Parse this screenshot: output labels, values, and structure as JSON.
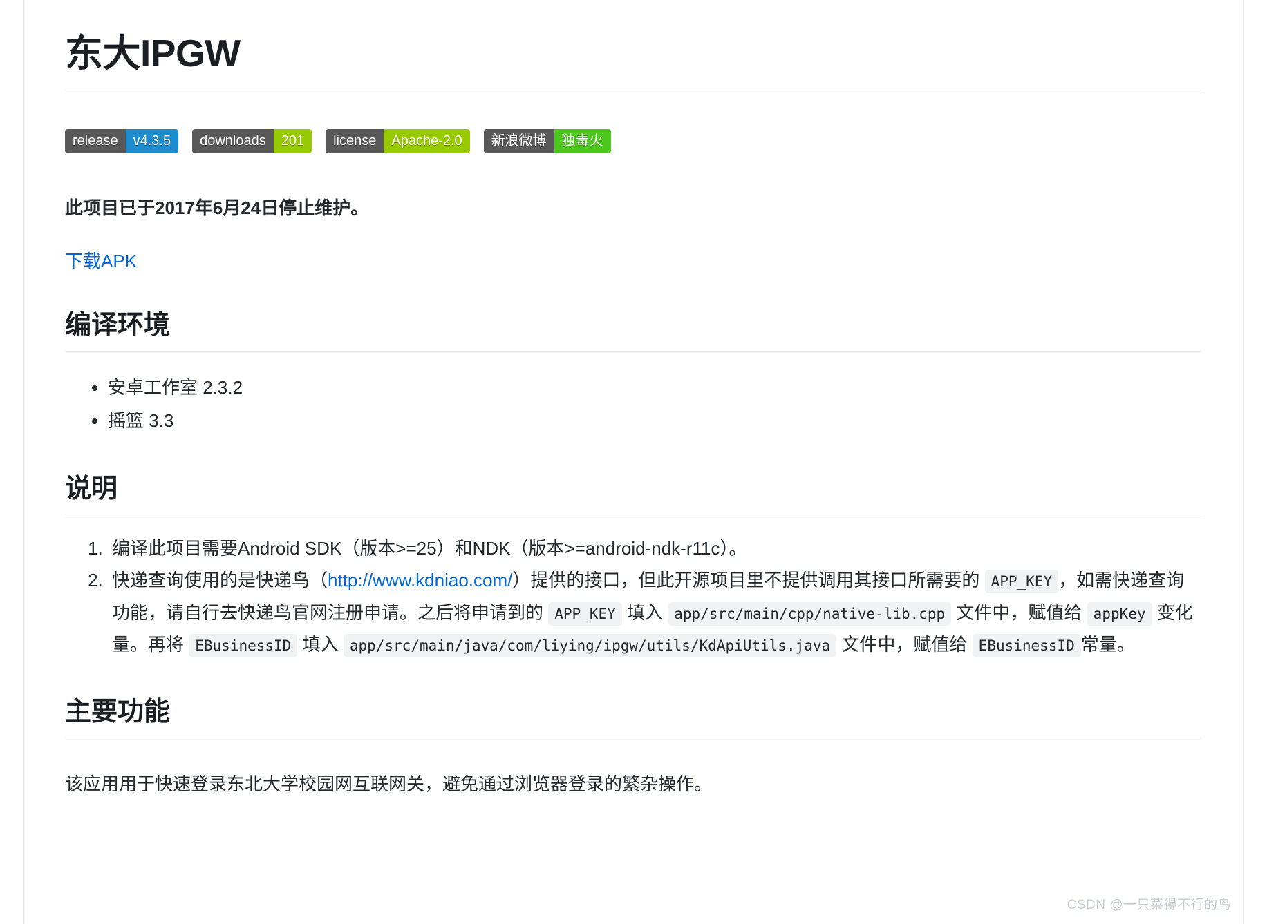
{
  "document": {
    "title": "东大IPGW"
  },
  "badges": [
    {
      "label": "release",
      "value": "v4.3.5",
      "label_color": "#595959",
      "value_color": "#1e8bcd"
    },
    {
      "label": "downloads",
      "value": "201",
      "label_color": "#595959",
      "value_color": "#97ca00"
    },
    {
      "label": "license",
      "value": "Apache-2.0",
      "label_color": "#595959",
      "value_color": "#97ca00"
    },
    {
      "label": "新浪微博",
      "value": "独毒火",
      "label_color": "#595959",
      "value_color": "#4cc71e"
    }
  ],
  "notice": "此项目已于2017年6月24日停止维护。",
  "download_link": {
    "text": "下载APK",
    "color": "#0366d6"
  },
  "sections": {
    "build_env": {
      "heading": "编译环境",
      "items": [
        "安卓工作室 2.3.2",
        "摇篮 3.3"
      ]
    },
    "instructions": {
      "heading": "说明",
      "item1": {
        "text": "编译此项目需要Android SDK（版本>=25）和NDK（版本>=android-ndk-r11c）。"
      },
      "item2": {
        "t1": "快递查询使用的是快递鸟（",
        "link": "http://www.kdniao.com/",
        "t2": "）提供的接口，但此开源项目里不提供调用其接口所需要的",
        "code1": "APP_KEY",
        "t3": "，如需快递查询功能，请自行去快递鸟官网注册申请。之后将申请到的",
        "code2": "APP_KEY",
        "t4": "填入",
        "code3": "app/src/main/cpp/native-lib.cpp",
        "t5": "文件中，赋值给",
        "code4": "appKey",
        "t6": "变化量。再将",
        "code5": "EBusinessID",
        "t7": "填入",
        "code6": "app/src/main/java/com/liying/ipgw/utils/KdApiUtils.java",
        "t8": "文件中，赋值给",
        "code7": "EBusinessID",
        "t9": "常量。"
      }
    },
    "main_features": {
      "heading": "主要功能",
      "paragraph": "该应用用于快速登录东北大学校园网互联网关，避免通过浏览器登录的繁杂操作。"
    }
  },
  "watermark": "CSDN @一只菜得不行的鸟"
}
